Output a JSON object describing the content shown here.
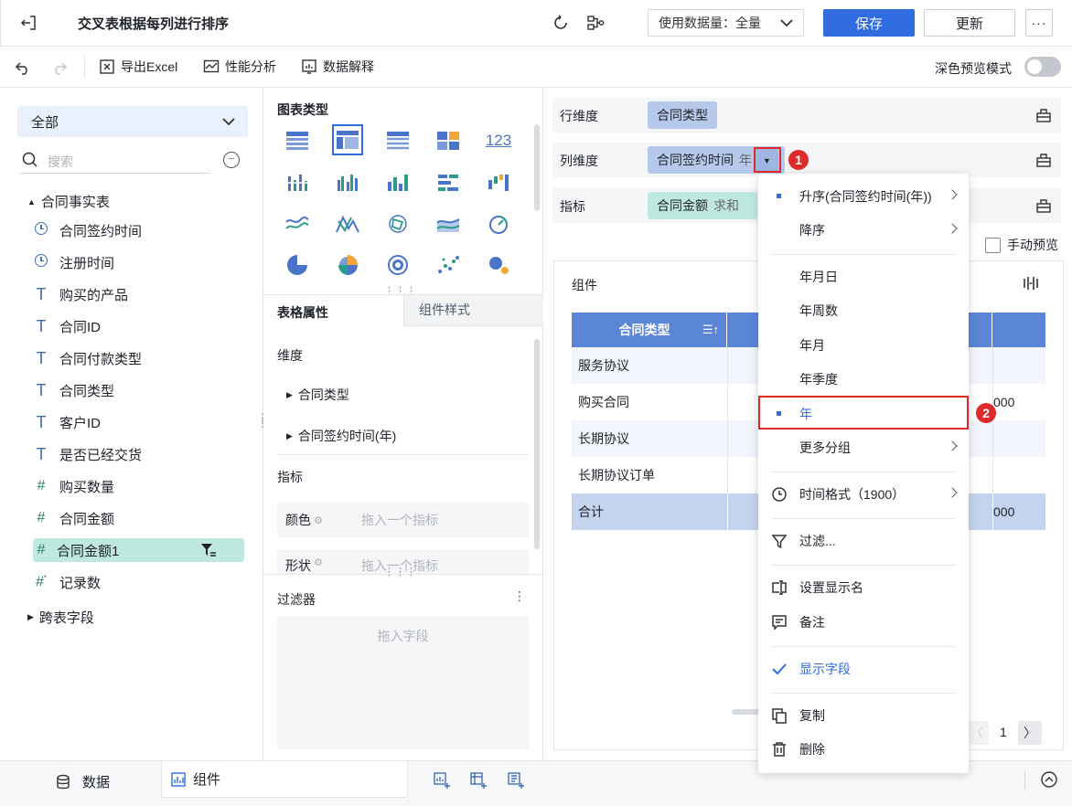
{
  "topbar": {
    "title": "交叉表根据每列进行排序",
    "data_amount_label": "使用数据量：全量",
    "save_label": "保存",
    "update_label": "更新",
    "more_label": "···"
  },
  "toolbar": {
    "export_label": "导出Excel",
    "perf_label": "性能分析",
    "explain_label": "数据解释",
    "dark_preview_label": "深色预览模式"
  },
  "left": {
    "scope_select": "全部",
    "search_placeholder": "搜索",
    "table_name": "合同事实表",
    "fields": [
      {
        "type": "date",
        "name": "合同签约时间"
      },
      {
        "type": "date",
        "name": "注册时间"
      },
      {
        "type": "text",
        "name": "购买的产品"
      },
      {
        "type": "text",
        "name": "合同ID"
      },
      {
        "type": "text",
        "name": "合同付款类型"
      },
      {
        "type": "text",
        "name": "合同类型"
      },
      {
        "type": "text",
        "name": "客户ID"
      },
      {
        "type": "text",
        "name": "是否已经交货"
      },
      {
        "type": "number",
        "name": "购买数量"
      },
      {
        "type": "number",
        "name": "合同金额"
      },
      {
        "type": "number",
        "name": "合同金额1"
      },
      {
        "type": "count",
        "name": "记录数"
      }
    ],
    "cross_table_label": "跨表字段"
  },
  "middle": {
    "chart_type_label": "图表类型",
    "tab_table_props": "表格属性",
    "tab_component_style": "组件样式",
    "dimension_label": "维度",
    "dimension_items": [
      "合同类型",
      "合同签约时间(年)"
    ],
    "metric_label": "指标",
    "color_label": "颜色",
    "shape_label": "形状",
    "drop_metric_placeholder": "拖入一个指标",
    "filter_label": "过滤器",
    "drop_field_placeholder": "拖入字段"
  },
  "right": {
    "row_dim_label": "行维度",
    "row_dim_value": "合同类型",
    "col_dim_label": "列维度",
    "col_dim_value": "合同签约时间",
    "col_dim_suffix": "年",
    "metric_label": "指标",
    "metric_value": "合同金额",
    "metric_suffix": "求和",
    "manual_preview_label": "手动预览",
    "widget_title": "组件",
    "table_header": "合同类型",
    "rows": [
      "服务协议",
      "购买合同",
      "长期协议",
      "长期协议订单",
      "合计"
    ],
    "partial_values": [
      "000",
      "000"
    ],
    "page_number": "1"
  },
  "menu": {
    "items": [
      {
        "label": "升序(合同签约时间(年))",
        "marked": true,
        "submenu": true
      },
      {
        "label": "降序",
        "marked": false,
        "submenu": true
      },
      {
        "label": "年月日"
      },
      {
        "label": "年周数"
      },
      {
        "label": "年月"
      },
      {
        "label": "年季度"
      },
      {
        "label": "年",
        "marked": true
      },
      {
        "label": "更多分组",
        "submenu": true
      },
      {
        "label": "时间格式（1900）",
        "icon": "clock-icon",
        "submenu": true
      },
      {
        "label": "过滤...",
        "icon": "filter-icon"
      },
      {
        "label": "设置显示名",
        "icon": "rename-icon"
      },
      {
        "label": "备注",
        "icon": "comment-icon"
      },
      {
        "label": "显示字段",
        "icon": "check-icon"
      },
      {
        "label": "复制",
        "icon": "copy-icon"
      },
      {
        "label": "删除",
        "icon": "trash-icon"
      }
    ]
  },
  "annotations": {
    "badge1": "1",
    "badge2": "2"
  },
  "bottom": {
    "data_tab": "数据",
    "component_tab": "组件"
  },
  "colors": {
    "accent": "#2f6de1",
    "dim_pill": "#b7c9ea",
    "metric_pill": "#bfe8e1",
    "table_header": "#5b85d6",
    "highlight": "#e02a2a"
  }
}
